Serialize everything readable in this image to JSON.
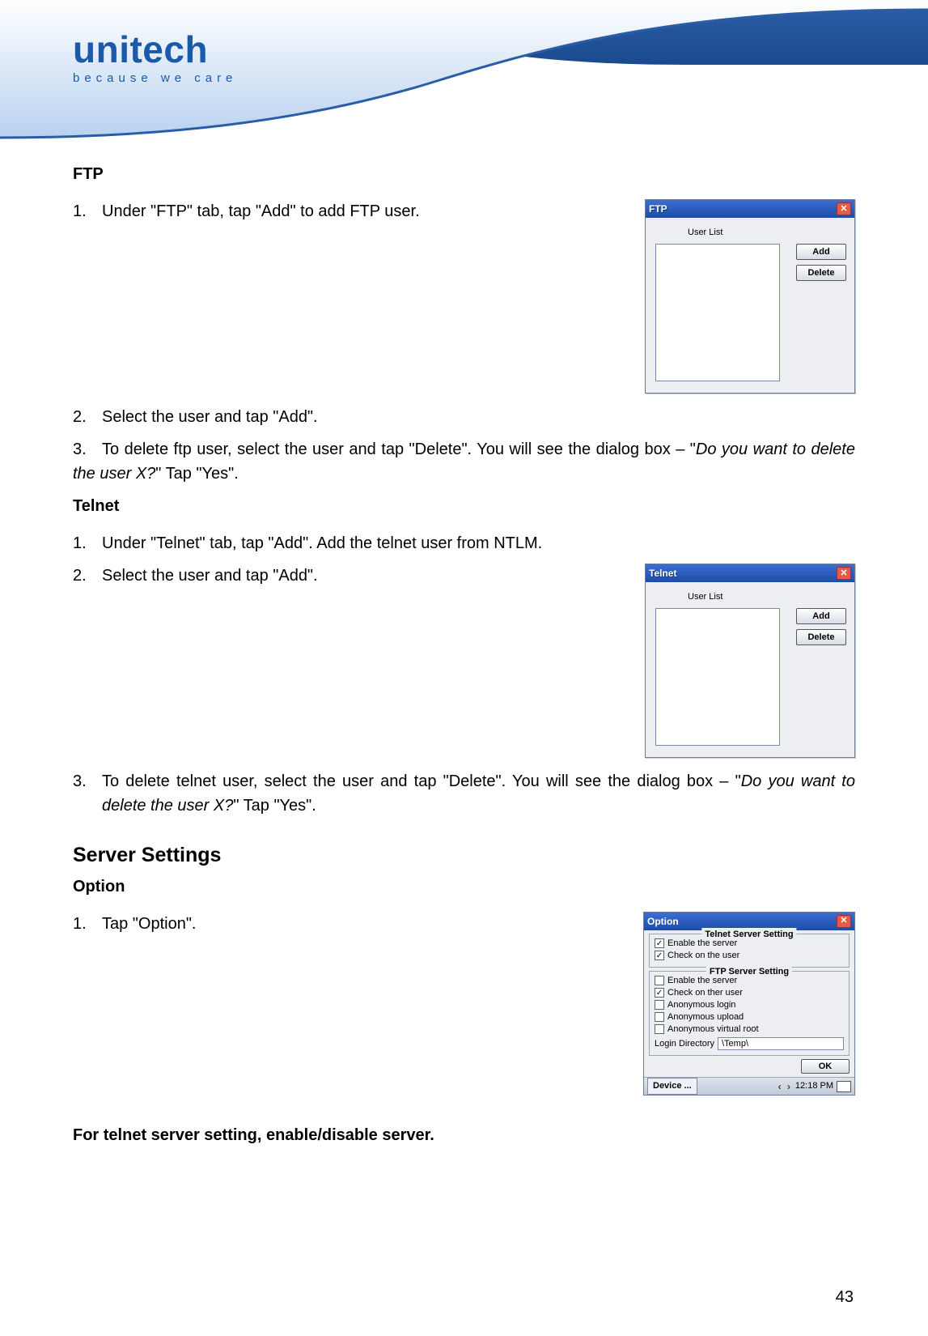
{
  "logo": {
    "name": "unitech",
    "tagline": "because we care"
  },
  "ftp": {
    "heading": "FTP",
    "step1_num": "1.",
    "step1": "Under \"FTP\" tab, tap \"Add\" to add FTP user.",
    "step2_num": "2.",
    "step2": "Select the user and tap \"Add\".",
    "step3_num": "3.",
    "step3_a": "To delete ftp user, select the user and tap \"Delete\". You will see the dialog box – \"",
    "step3_i": "Do you want to delete the user X?",
    "step3_b": "\" Tap \"Yes\"."
  },
  "telnet": {
    "heading": "Telnet",
    "step1_num": "1.",
    "step1": "Under \"Telnet\" tab, tap \"Add\". Add the telnet user from NTLM.",
    "step2_num": "2.",
    "step2": "Select the user and tap \"Add\".",
    "step3_num": "3.",
    "step3_a": "To delete telnet user, select the user and tap \"Delete\". You will see the dialog box – \"",
    "step3_i": "Do you want to delete the user X?",
    "step3_b": "\" Tap \"Yes\"."
  },
  "server": {
    "heading": "Server Settings",
    "option_heading": "Option",
    "step1_num": "1.",
    "step1": "Tap \"Option\".",
    "note": "For telnet server setting, enable/disable server."
  },
  "dialog_ftp": {
    "title": "FTP",
    "user_list_label": "User List",
    "add_btn": "Add",
    "delete_btn": "Delete"
  },
  "dialog_telnet": {
    "title": "Telnet",
    "user_list_label": "User List",
    "add_btn": "Add",
    "delete_btn": "Delete"
  },
  "dialog_option": {
    "title": "Option",
    "telnet_group": "Telnet Server Setting",
    "telnet_chk1": "Enable the server",
    "telnet_chk2": "Check on the user",
    "ftp_group": "FTP Server Setting",
    "ftp_chk1": "Enable the server",
    "ftp_chk2": "Check on ther user",
    "ftp_chk3": "Anonymous login",
    "ftp_chk4": "Anonymous upload",
    "ftp_chk5": "Anonymous virtual root",
    "login_dir_label": "Login Directory",
    "login_dir_value": "\\Temp\\",
    "ok_btn": "OK",
    "task_device": "Device ...",
    "task_time": "12:18 PM"
  },
  "page_number": "43"
}
